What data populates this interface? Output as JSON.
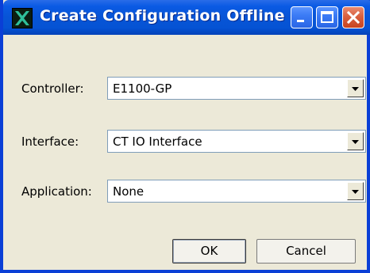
{
  "window": {
    "title": "Create Configuration Offline",
    "colors": {
      "titlebar": "#0754D6",
      "client": "#ECE9D8",
      "close_button": "#D9603F"
    }
  },
  "titlebar": {
    "icons": [
      "app-icon",
      "minimize-icon",
      "maximize-icon",
      "close-icon"
    ]
  },
  "form": {
    "controller": {
      "label": "Controller:",
      "value": "E1100-GP"
    },
    "interface": {
      "label": "Interface:",
      "value": "CT IO Interface"
    },
    "application": {
      "label": "Application:",
      "value": "None"
    }
  },
  "buttons": {
    "ok": "OK",
    "cancel": "Cancel"
  }
}
